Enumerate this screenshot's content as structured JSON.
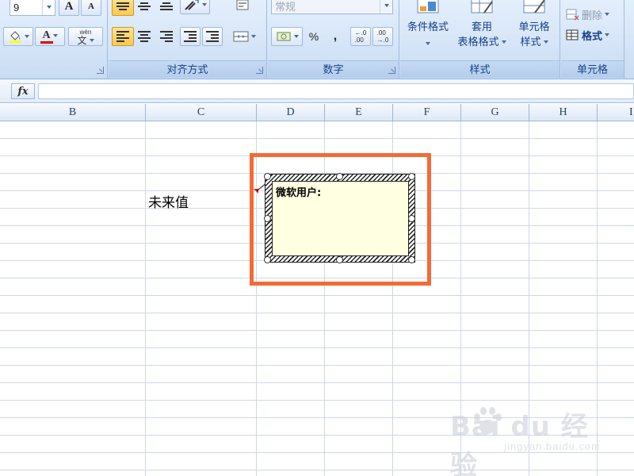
{
  "ribbon": {
    "font": {
      "size_value": "9",
      "grow_label": "A",
      "shrink_label": "A",
      "font_color_label": "A",
      "phonetic_top": "wén",
      "phonetic_bottom": "文"
    },
    "alignment": {
      "label": "对齐方式"
    },
    "number": {
      "label": "数字",
      "format_value": "常规",
      "percent_label": "%",
      "comma_label": ",",
      "increase_decimal_label": "←.0\n.00",
      "decrease_decimal_label": ".00\n→.0"
    },
    "styles": {
      "label": "样式",
      "conditional_format_label": "条件格式",
      "table_format_line1": "套用",
      "table_format_line2": "表格格式",
      "cell_styles_line1": "单元格",
      "cell_styles_line2": "样式"
    },
    "cells": {
      "label": "单元格",
      "delete_label": "删除",
      "format_label": "格式"
    }
  },
  "formula_bar": {
    "fx_label": "fx",
    "value": ""
  },
  "columns": [
    "B",
    "C",
    "D",
    "E",
    "F",
    "G",
    "H",
    "I"
  ],
  "cells": {
    "C5": "未来值"
  },
  "comment": {
    "author": "微软用户:"
  },
  "watermark": {
    "logo": "Bai du 经验",
    "url": "jingyan.baidu.com"
  },
  "colors": {
    "highlight": "#f26b38",
    "comment_bg": "#ffffe1",
    "indicator": "#e02020"
  }
}
